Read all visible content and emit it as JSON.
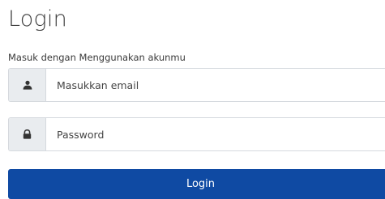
{
  "login": {
    "title": "Login",
    "subtitle": "Masuk dengan Menggunakan akunmu",
    "email": {
      "icon": "user-icon",
      "placeholder": "Masukkan email",
      "value": ""
    },
    "password": {
      "icon": "lock-icon",
      "placeholder": "Password",
      "value": ""
    },
    "button_label": "Login"
  },
  "colors": {
    "primary": "#0f4aa3",
    "addon_bg": "#e9ecef",
    "border": "#d5d9de",
    "icon": "#333333"
  }
}
